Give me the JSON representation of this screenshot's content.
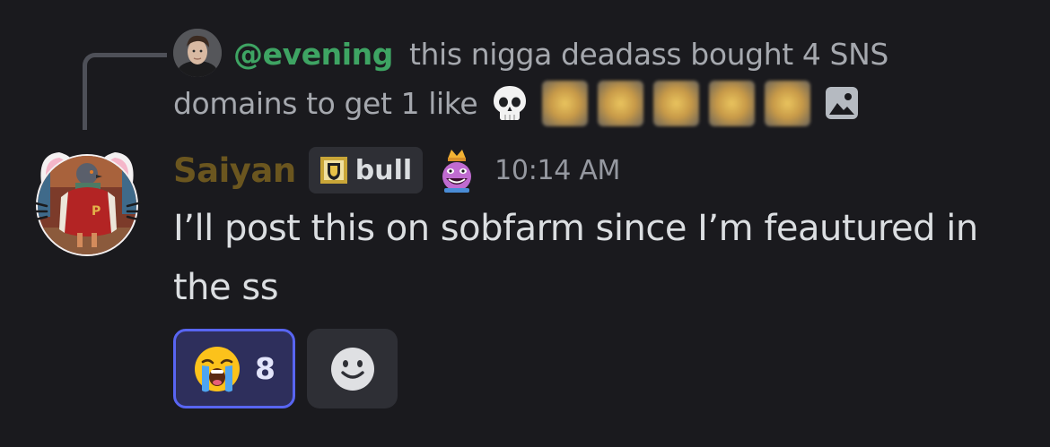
{
  "reply": {
    "author": "@evening",
    "text_line1": "this nigga deadass bought 4 SNS",
    "text_line2": "domains to get 1 like",
    "emoji": "skull-icon",
    "blurred_emoji_count": 5,
    "attachment_icon": "image-icon",
    "author_color": "#3ea463"
  },
  "message": {
    "username": "Saiyan",
    "username_color": "#6b561f",
    "tag": {
      "label": "bull",
      "icon": "crest-icon"
    },
    "badge_icon": "king-icon",
    "timestamp": "10:14 AM",
    "content": "I’ll post this on sobfarm since I’m feautured in the ss"
  },
  "reactions": [
    {
      "emoji": "loudly-crying-face-icon",
      "count": "8",
      "active": true
    }
  ],
  "add_reaction_icon": "smiley-add-reaction-icon",
  "accent_color": "#5865f2"
}
